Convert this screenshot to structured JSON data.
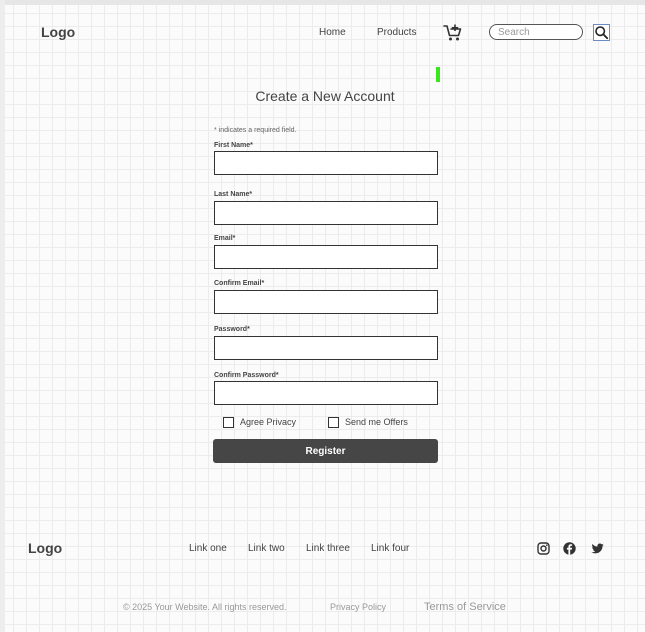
{
  "header": {
    "logo": "Logo",
    "nav": [
      "Home",
      "Products"
    ],
    "search_placeholder": "Search"
  },
  "icons": {
    "cart": "cart-plus-icon",
    "search": "magnifier-icon",
    "social": [
      "instagram-icon",
      "facebook-icon",
      "twitter-icon"
    ]
  },
  "form": {
    "title": "Create a New Account",
    "required_note": "* indicates a required field.",
    "fields": [
      {
        "label": "First Name*"
      },
      {
        "label": "Last Name*"
      },
      {
        "label": "Email*"
      },
      {
        "label": "Confirm Email*"
      },
      {
        "label": "Password*"
      },
      {
        "label": "Confirm Password*"
      }
    ],
    "checkboxes": [
      {
        "label": "Agree Privacy"
      },
      {
        "label": "Send me Offers"
      }
    ],
    "submit": "Register"
  },
  "footer": {
    "logo": "Logo",
    "links": [
      "Link one",
      "Link two",
      "Link three",
      "Link four"
    ],
    "copyright": "© 2025 Your Website. All rights reserved.",
    "privacy": "Privacy Policy",
    "terms": "Terms of Service"
  },
  "colors": {
    "accent_green": "#3ae61e",
    "button_bg": "#464646",
    "search_outline": "#6a8cc7"
  }
}
